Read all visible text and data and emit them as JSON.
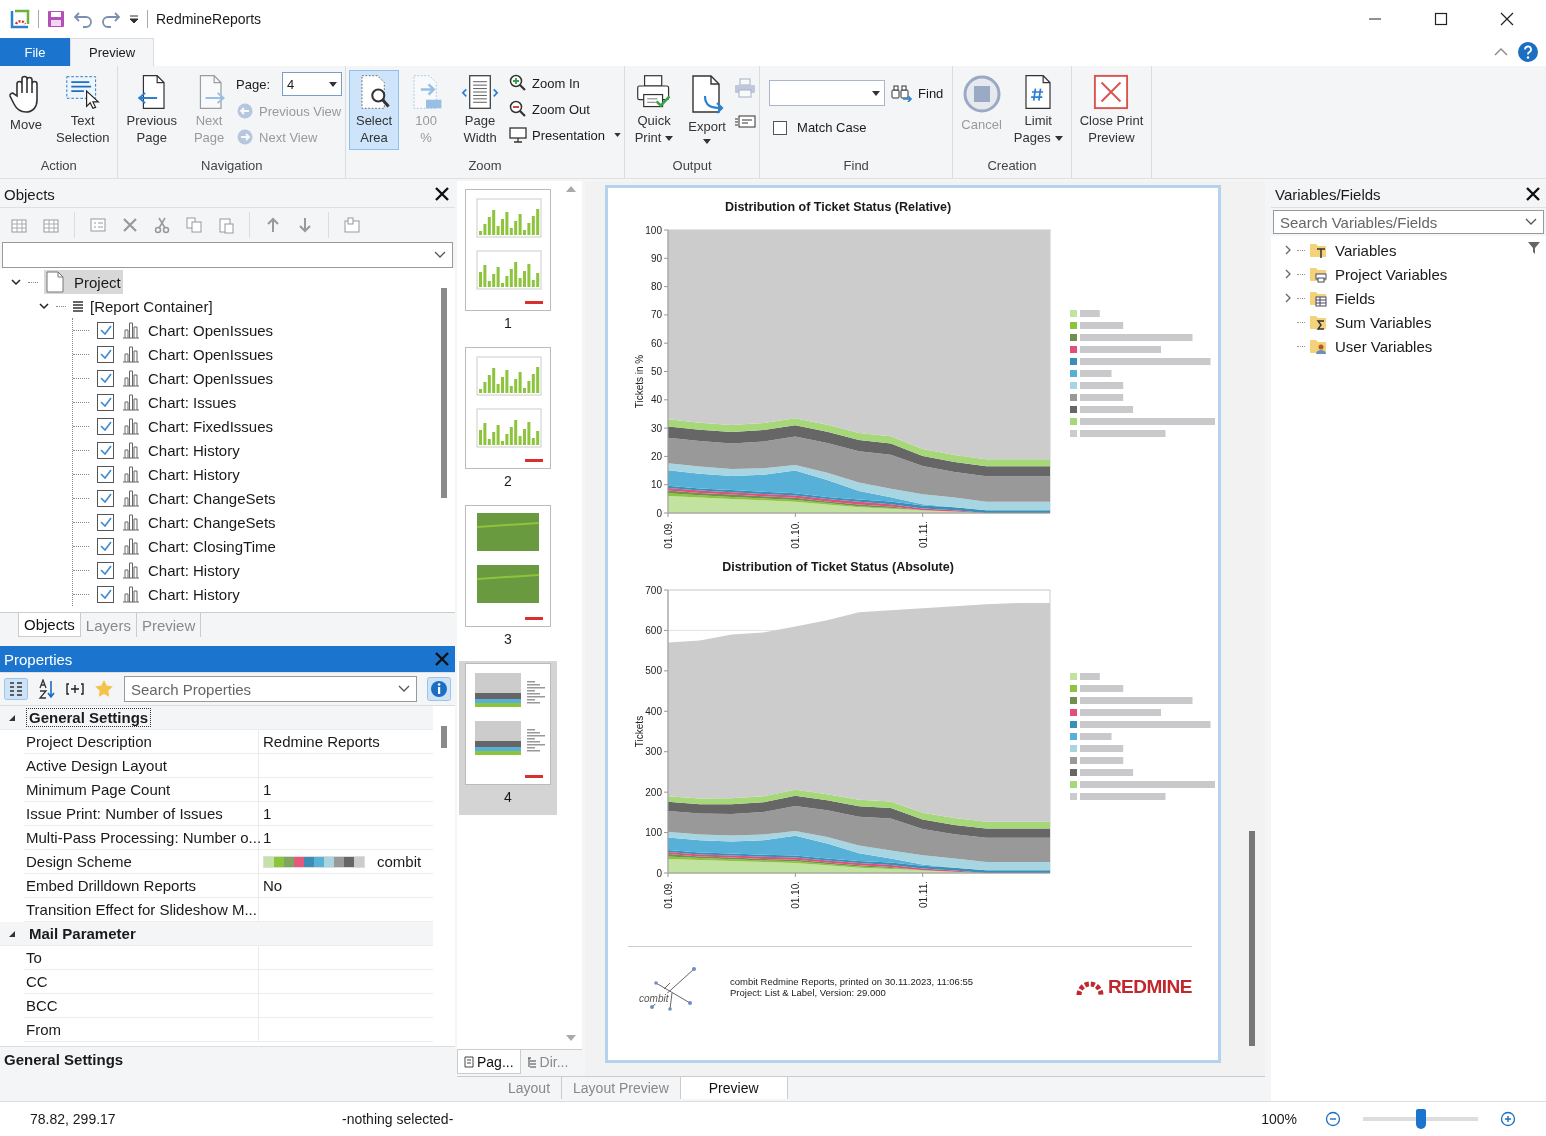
{
  "window": {
    "title": "RedmineReports"
  },
  "ribbon_tabs": [
    {
      "label": "File",
      "kind": "file",
      "selected": false
    },
    {
      "label": "Preview",
      "kind": "tab",
      "selected": true
    }
  ],
  "ribbon": [
    {
      "group": "Action",
      "buttons": [
        {
          "label": "Move",
          "disabled": false
        },
        {
          "label": "Text\nSelection",
          "disabled": false
        }
      ]
    },
    {
      "group": "Navigation",
      "buttons": [
        {
          "label": "Previous\nPage",
          "disabled": false
        },
        {
          "label": "Next\nPage",
          "disabled": true
        }
      ],
      "page": {
        "label": "Page:",
        "value": "4"
      },
      "small": [
        {
          "label": "Previous View",
          "disabled": true
        },
        {
          "label": "Next View",
          "disabled": true
        }
      ]
    },
    {
      "group": "Zoom",
      "buttons": [
        {
          "label": "Select\nArea",
          "disabled": false,
          "selected": true
        },
        {
          "label": "100\n%",
          "disabled": true,
          "selected": false
        },
        {
          "label": "Page\nWidth",
          "disabled": false,
          "selected": false
        }
      ],
      "small": [
        {
          "label": "Zoom In",
          "disabled": false,
          "dropdown": false
        },
        {
          "label": "Zoom Out",
          "disabled": false,
          "dropdown": false
        },
        {
          "label": "Presentation",
          "disabled": false,
          "dropdown": true
        }
      ]
    },
    {
      "group": "Output",
      "buttons": [
        {
          "label": "Quick\nPrint",
          "disabled": false,
          "dropdown": true
        },
        {
          "label": "Export",
          "disabled": false,
          "dropdown": true
        }
      ],
      "icon_buttons": [
        {
          "disabled": true
        },
        {
          "disabled": false
        }
      ]
    },
    {
      "group": "Find",
      "find_button": "Find",
      "match_case": {
        "label": "Match Case",
        "checked": false
      }
    },
    {
      "group": "Creation",
      "buttons": [
        {
          "label": "Cancel",
          "disabled": true,
          "dropdown": false
        },
        {
          "label": "Limit\nPages",
          "disabled": false,
          "dropdown": true
        }
      ]
    },
    {
      "buttons": [
        {
          "label": "Close Print\nPreview",
          "disabled": false,
          "dropdown": false
        }
      ]
    }
  ],
  "objects_panel": {
    "title": "Objects",
    "tree": [
      {
        "label": "Project",
        "selected": true,
        "expanded": true,
        "children": [
          {
            "label": "[Report Container]",
            "expanded": true,
            "children": [
              {
                "label": "Chart: OpenIssues",
                "checked": true
              },
              {
                "label": "Chart: OpenIssues",
                "checked": true
              },
              {
                "label": "Chart: OpenIssues",
                "checked": true
              },
              {
                "label": "Chart: Issues",
                "checked": true
              },
              {
                "label": "Chart: FixedIssues",
                "checked": true
              },
              {
                "label": "Chart: History",
                "checked": true
              },
              {
                "label": "Chart: History",
                "checked": true
              },
              {
                "label": "Chart: ChangeSets",
                "checked": true
              },
              {
                "label": "Chart: ChangeSets",
                "checked": true
              },
              {
                "label": "Chart: ClosingTime",
                "checked": true
              },
              {
                "label": "Chart: History",
                "checked": true
              },
              {
                "label": "Chart: History",
                "checked": true
              }
            ]
          }
        ]
      }
    ],
    "tabs": [
      {
        "label": "Objects",
        "selected": true
      },
      {
        "label": "Layers",
        "selected": false
      },
      {
        "label": "Preview",
        "selected": false
      }
    ]
  },
  "properties_panel": {
    "title": "Properties",
    "search_placeholder": "Search Properties",
    "categories": [
      {
        "label": "General Settings",
        "expanded": true,
        "rows": [
          {
            "name": "Project Description",
            "value": "Redmine Reports"
          },
          {
            "name": "Active Design Layout"
          },
          {
            "name": "Minimum Page Count",
            "value": "1"
          },
          {
            "name": "Issue Print: Number of Issues",
            "value": "1"
          },
          {
            "name": "Multi-Pass Processing: Number o...",
            "value": "1"
          },
          {
            "name": "Design Scheme",
            "value": "combit",
            "swatches": [
              {
                "color": "#c5e2a6"
              },
              {
                "color": "#8cc43c"
              },
              {
                "color": "#7fa661"
              },
              {
                "color": "#e8577e"
              },
              {
                "color": "#3d8db5"
              },
              {
                "color": "#58b1d6"
              },
              {
                "color": "#a9d4e0"
              },
              {
                "color": "#999999"
              },
              {
                "color": "#666666"
              },
              {
                "color": "#cccccc"
              }
            ]
          },
          {
            "name": "Embed Drilldown Reports",
            "value": "No"
          },
          {
            "name": "Transition Effect for Slideshow M..."
          }
        ]
      },
      {
        "label": "Mail Parameter",
        "expanded": true,
        "rows": [
          {
            "name": "To"
          },
          {
            "name": "CC"
          },
          {
            "name": "BCC"
          },
          {
            "name": "From"
          }
        ]
      }
    ],
    "description_title": "General Settings"
  },
  "pages": [
    {
      "number": "1",
      "kind": "bars",
      "selected": false
    },
    {
      "number": "2",
      "kind": "bars",
      "selected": false
    },
    {
      "number": "3",
      "kind": "area",
      "selected": false
    },
    {
      "number": "4",
      "kind": "stacked",
      "selected": true
    }
  ],
  "pages_tabs": [
    {
      "label": "Pag...",
      "selected": true
    },
    {
      "label": "Dir...",
      "selected": false
    }
  ],
  "preview": {
    "charts": [
      {
        "chart_data": {
          "type": "area",
          "title": "Distribution of Ticket Status (Relative)",
          "ylabel": "Tickets in %",
          "stacked": true,
          "categories": [
            "01.09.",
            null,
            null,
            null,
            "01.10.",
            null,
            null,
            null,
            "01.11.",
            null,
            null,
            null,
            null
          ],
          "ylim": [
            0,
            100
          ],
          "yticks": [
            0,
            10,
            20,
            30,
            40,
            50,
            60,
            70,
            80,
            90,
            100
          ],
          "series": [
            {
              "color": "#c2e29f",
              "values": [
                6,
                5.5,
                5,
                4.5,
                4,
                3,
                2,
                1.5,
                1,
                0.5,
                0,
                0,
                0
              ]
            },
            {
              "color": "#8cc43c",
              "values": [
                1,
                0.8,
                0.7,
                0.6,
                0.6,
                0.5,
                0.4,
                0.3,
                0,
                0,
                0,
                0,
                0
              ]
            },
            {
              "color": "#6f8f4f",
              "values": [
                1,
                0.8,
                0.8,
                0.8,
                0.8,
                0.6,
                0.6,
                0.5,
                0,
                0,
                0,
                0,
                0
              ]
            },
            {
              "color": "#e0507a",
              "values": [
                0.8,
                0.8,
                0.8,
                0.8,
                0.8,
                0.8,
                1,
                0.8,
                0.6,
                0.5,
                0,
                0,
                0
              ]
            },
            {
              "color": "#3a8fb7",
              "values": [
                0.8,
                0.8,
                0.8,
                0.8,
                0.8,
                0.8,
                0.8,
                1,
                1,
                1,
                1,
                1,
                1
              ]
            },
            {
              "color": "#56b0d8",
              "values": [
                5.5,
                5.2,
                5,
                6,
                8,
                6,
                3,
                1.5,
                0.5,
                0,
                0,
                0,
                0
              ]
            },
            {
              "color": "#a8d5e2",
              "values": [
                2.5,
                2.5,
                2.5,
                2.3,
                2,
                2.5,
                3,
                3,
                3.5,
                3.5,
                3,
                3,
                3
              ]
            },
            {
              "color": "#999999",
              "values": [
                9,
                9,
                9,
                9.5,
                10,
                10.5,
                11,
                12,
                10,
                9,
                9,
                9,
                9
              ]
            },
            {
              "color": "#666666",
              "values": [
                4,
                4,
                4,
                4,
                4,
                4,
                4,
                4,
                3.5,
                3.5,
                3.5,
                3.5,
                3.5
              ]
            },
            {
              "color": "#a6d87a",
              "values": [
                2.5,
                2.5,
                2.5,
                2.5,
                2.5,
                2.5,
                2.5,
                2.5,
                2.5,
                2.5,
                2.5,
                2.5,
                2.5
              ]
            },
            {
              "color": "#cccccc",
              "values": [
                66.9,
                68.1,
                68.9,
                68.2,
                66.5,
                68.8,
                71.7,
                72.9,
                77.4,
                79.5,
                81,
                81,
                81
              ]
            }
          ]
        }
      },
      {
        "chart_data": {
          "type": "area",
          "title": "Distribution of Ticket Status (Absolute)",
          "ylabel": "Tickets",
          "stacked": true,
          "categories": [
            "01.09.",
            null,
            null,
            null,
            "01.10.",
            null,
            null,
            null,
            "01.11.",
            null,
            null,
            null,
            null
          ],
          "ylim": [
            0,
            700
          ],
          "yticks": [
            0,
            100,
            200,
            300,
            400,
            500,
            600,
            700
          ],
          "series": [
            {
              "color": "#c2e29f",
              "values": [
                35,
                32,
                30,
                27,
                25,
                19,
                13,
                10,
                7,
                3,
                0,
                0,
                0
              ]
            },
            {
              "color": "#8cc43c",
              "values": [
                6,
                5,
                4,
                4,
                4,
                3,
                3,
                2,
                0,
                0,
                0,
                0,
                0
              ]
            },
            {
              "color": "#6f8f4f",
              "values": [
                6,
                4,
                4,
                4,
                4,
                4,
                3,
                3,
                0,
                0,
                0,
                0,
                0
              ]
            },
            {
              "color": "#e0507a",
              "values": [
                5,
                5,
                5,
                5,
                5,
                5,
                6,
                5,
                4,
                3,
                0,
                0,
                0
              ]
            },
            {
              "color": "#3a8fb7",
              "values": [
                5,
                5,
                5,
                5,
                5,
                5,
                5,
                6,
                7,
                7,
                7,
                7,
                7
              ]
            },
            {
              "color": "#56b0d8",
              "values": [
                31,
                30,
                30,
                36,
                49,
                37,
                19,
                10,
                3,
                0,
                0,
                0,
                0
              ]
            },
            {
              "color": "#a8d5e2",
              "values": [
                14,
                14,
                15,
                14,
                12,
                16,
                19,
                20,
                23,
                23,
                20,
                20,
                20
              ]
            },
            {
              "color": "#999999",
              "values": [
                51,
                52,
                53,
                56,
                62,
                66,
                71,
                79,
                65,
                60,
                60,
                60,
                60
              ]
            },
            {
              "color": "#666666",
              "values": [
                23,
                23,
                24,
                24,
                25,
                25,
                26,
                26,
                23,
                23,
                23,
                23,
                23
              ]
            },
            {
              "color": "#a6d87a",
              "values": [
                14,
                14,
                15,
                15,
                15,
                15,
                16,
                16,
                17,
                17,
                17,
                17,
                17
              ]
            },
            {
              "color": "#cccccc",
              "values": [
                380,
                391,
                405,
                405,
                404,
                430,
                464,
                473,
                506,
                524,
                538,
                541,
                541
              ]
            }
          ]
        }
      }
    ],
    "footer": {
      "logo_text": "combit",
      "lines": [
        "combit Redmine Reports, printed on 30.11.2023, 11:06:55",
        "Project: List & Label, Version: 29.000"
      ],
      "brand": "REDMINE"
    }
  },
  "view_tabs": [
    {
      "label": "Layout",
      "selected": false
    },
    {
      "label": "Layout Preview",
      "selected": false
    },
    {
      "label": "Preview",
      "selected": true
    }
  ],
  "variables_panel": {
    "title": "Variables/Fields",
    "search_placeholder": "Search Variables/Fields",
    "items": [
      {
        "label": "Variables",
        "expanded": false
      },
      {
        "label": "Project Variables",
        "expanded": false
      },
      {
        "label": "Fields",
        "expanded": false
      },
      {
        "label": "Sum Variables"
      },
      {
        "label": "User Variables"
      }
    ]
  },
  "status_bar": {
    "position": "78.82, 299.17",
    "selection": "-nothing selected-",
    "zoom": "100%",
    "zoom_slider": {
      "level": 0.5
    }
  }
}
